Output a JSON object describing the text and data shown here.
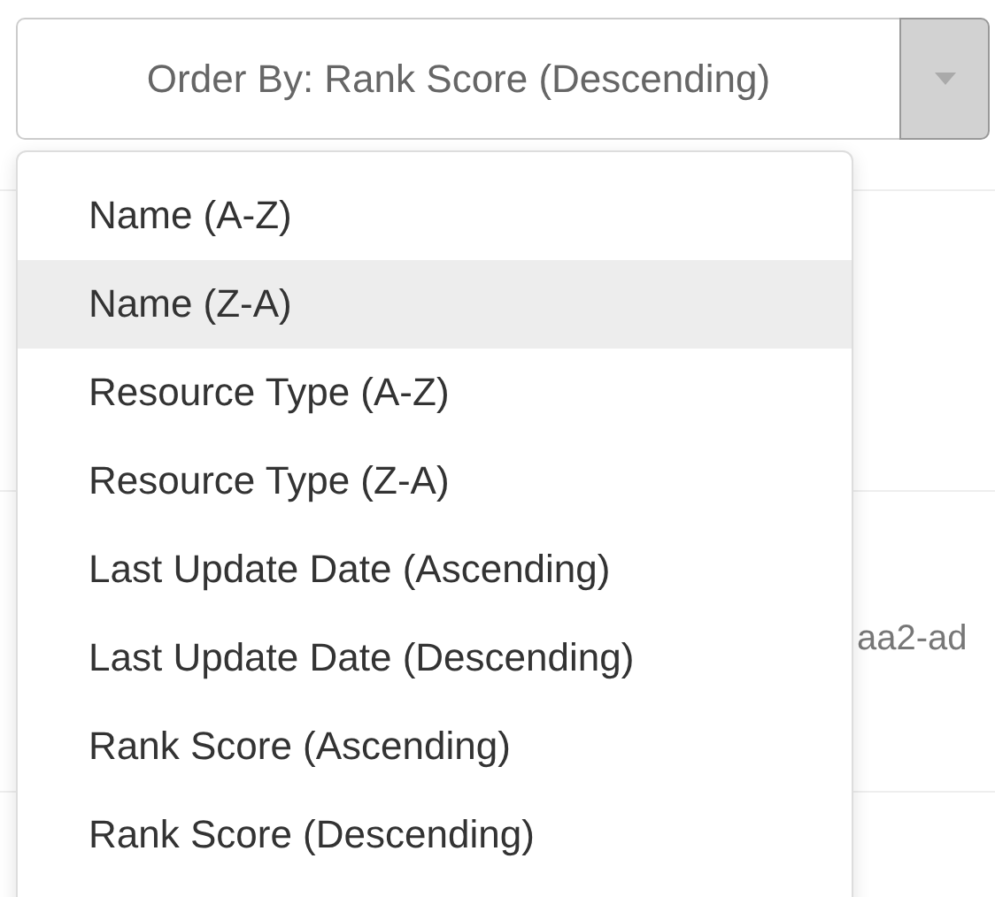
{
  "order_select": {
    "value": "Order By: Rank Score (Descending)"
  },
  "background_rows": [
    {
      "text": ""
    },
    {
      "text": "aa2-ad"
    },
    {
      "text": ""
    }
  ],
  "menu": {
    "items": [
      {
        "label": "Name (A-Z)",
        "highlighted": false
      },
      {
        "label": "Name (Z-A)",
        "highlighted": true
      },
      {
        "label": "Resource Type (A-Z)",
        "highlighted": false
      },
      {
        "label": "Resource Type (Z-A)",
        "highlighted": false
      },
      {
        "label": "Last Update Date (Ascending)",
        "highlighted": false
      },
      {
        "label": "Last Update Date (Descending)",
        "highlighted": false
      },
      {
        "label": "Rank Score (Ascending)",
        "highlighted": false
      },
      {
        "label": "Rank Score (Descending)",
        "highlighted": false
      }
    ]
  }
}
